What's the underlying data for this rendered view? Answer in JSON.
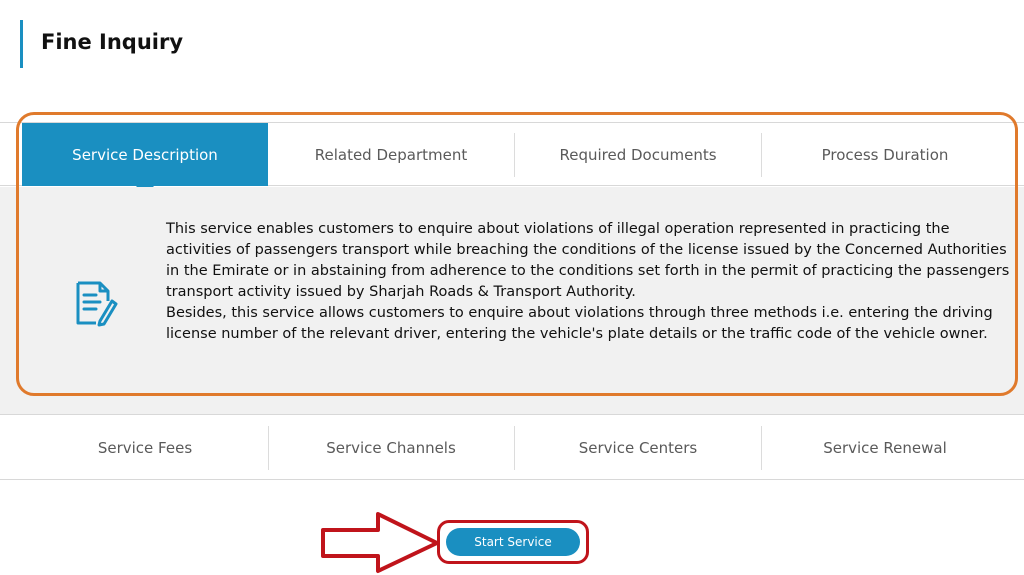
{
  "page": {
    "title": "Fine Inquiry"
  },
  "tabs_top": [
    {
      "label": "Service Description",
      "active": true
    },
    {
      "label": "Related Department",
      "active": false
    },
    {
      "label": "Required Documents",
      "active": false
    },
    {
      "label": "Process Duration",
      "active": false
    }
  ],
  "description": {
    "paragraph1": "This service enables customers to enquire about violations of illegal operation represented in practicing the activities of passengers transport while breaching the conditions of the license issued by the Concerned Authorities in the Emirate or in abstaining from adherence to the conditions set forth in the permit of practicing the passengers transport activity issued by Sharjah Roads & Transport Authority.",
    "paragraph2": "Besides, this service allows customers to enquire about violations through three methods i.e. entering the driving license number of the relevant driver, entering the vehicle's plate details or the traffic code of the vehicle owner.",
    "icon": "document-edit-icon"
  },
  "tabs_bottom": [
    {
      "label": "Service Fees"
    },
    {
      "label": "Service Channels"
    },
    {
      "label": "Service Centers"
    },
    {
      "label": "Service Renewal"
    }
  ],
  "actions": {
    "start_label": "Start Service"
  },
  "colors": {
    "accent": "#1a8fc1",
    "highlight_orange": "#e07a2c",
    "highlight_red": "#c0141b",
    "panel_bg": "#f1f1f1"
  }
}
